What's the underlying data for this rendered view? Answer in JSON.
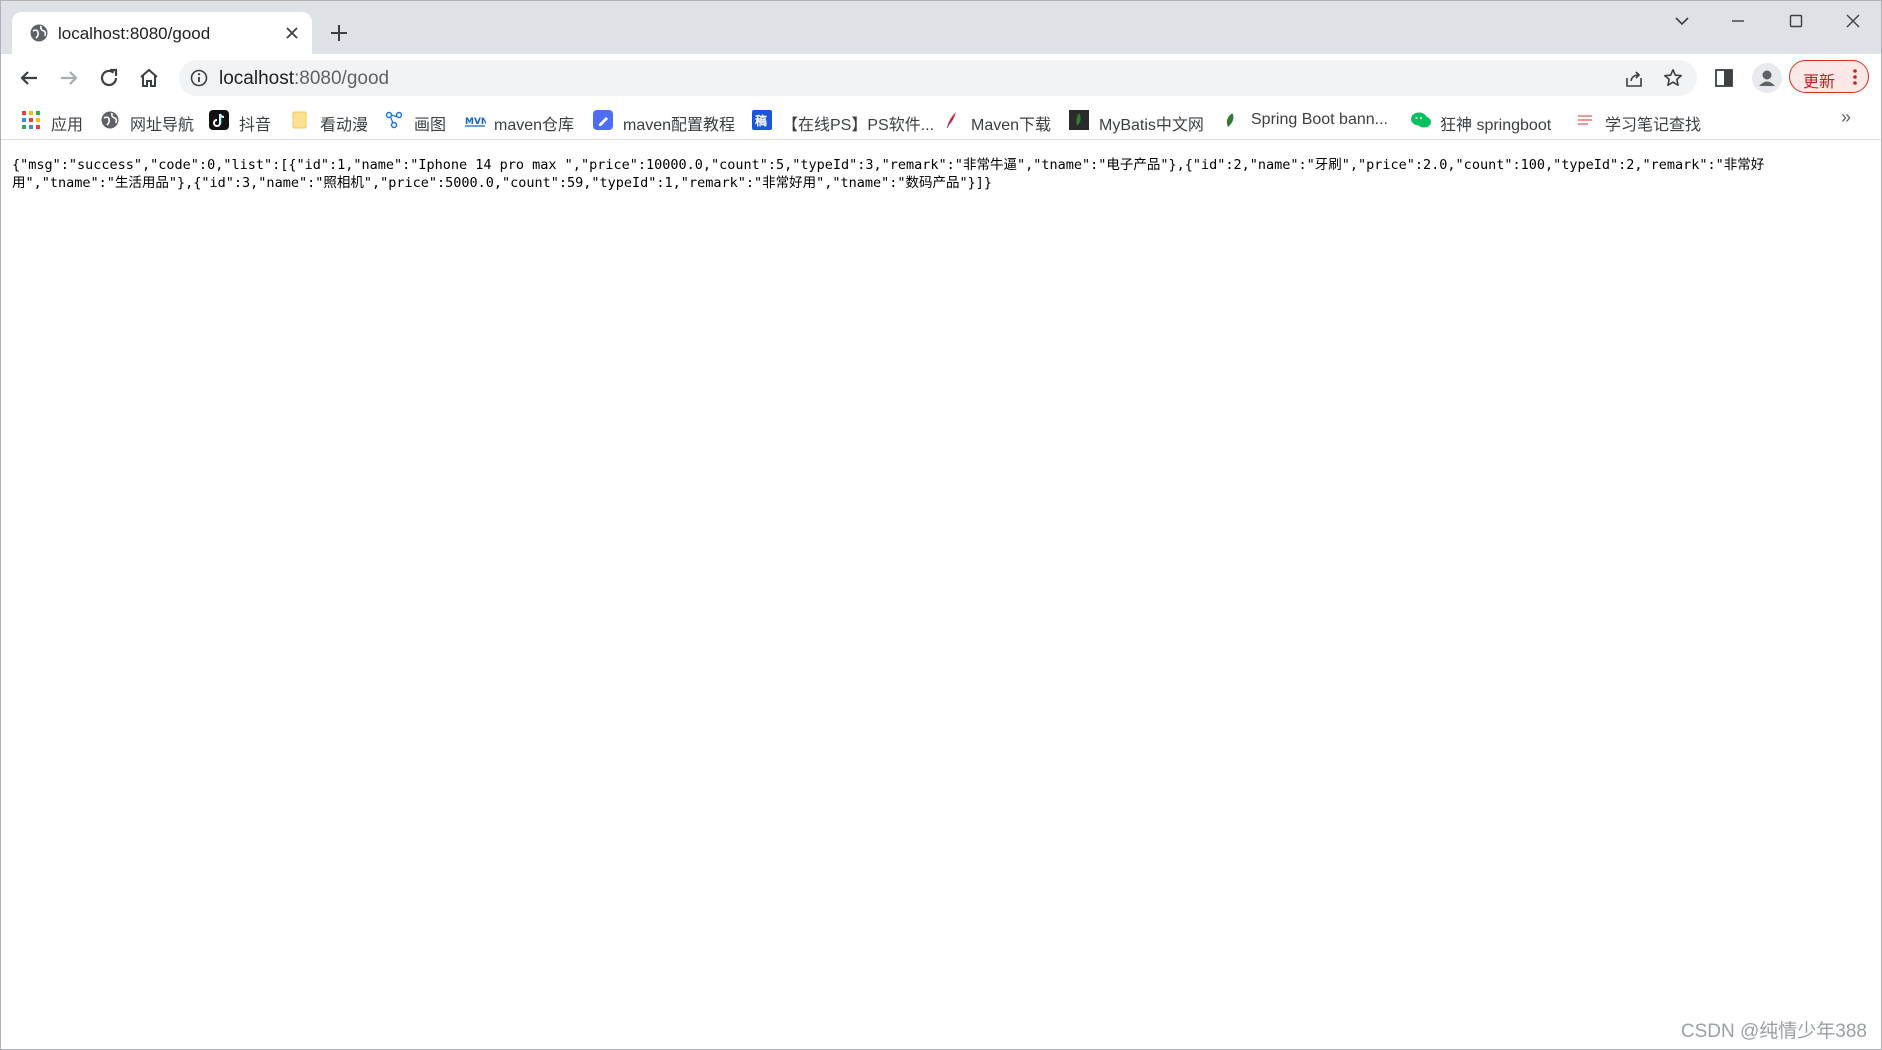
{
  "tab": {
    "title": "localhost:8080/good"
  },
  "toolbar": {
    "url_host": "localhost",
    "url_path": ":8080/good",
    "update_label": "更新"
  },
  "bookmarks": [
    {
      "label": "应用",
      "icon": "apps-grid-icon"
    },
    {
      "label": "网址导航",
      "icon": "globe-icon"
    },
    {
      "label": "抖音",
      "icon": "douyin-icon"
    },
    {
      "label": "看动漫",
      "icon": "folder-icon"
    },
    {
      "label": "画图",
      "icon": "graph-icon"
    },
    {
      "label": "maven仓库",
      "icon": "mvn-icon"
    },
    {
      "label": "maven配置教程",
      "icon": "doc-icon"
    },
    {
      "label": "【在线PS】PS软件...",
      "icon": "ps-icon"
    },
    {
      "label": "Maven下载",
      "icon": "feather-icon"
    },
    {
      "label": "MyBatis中文网",
      "icon": "mybatis-icon"
    },
    {
      "label": "Spring Boot bann...",
      "icon": "leaf-icon"
    },
    {
      "label": "狂神 springboot",
      "icon": "wechat-icon"
    },
    {
      "label": "学习笔记查找",
      "icon": "notes-icon"
    }
  ],
  "page": {
    "json_text": "{\"msg\":\"success\",\"code\":0,\"list\":[{\"id\":1,\"name\":\"Iphone 14 pro max \",\"price\":10000.0,\"count\":5,\"typeId\":3,\"remark\":\"非常牛逼\",\"tname\":\"电子产品\"},{\"id\":2,\"name\":\"牙刷\",\"price\":2.0,\"count\":100,\"typeId\":2,\"remark\":\"非常好用\",\"tname\":\"生活用品\"},{\"id\":3,\"name\":\"照相机\",\"price\":5000.0,\"count\":59,\"typeId\":1,\"remark\":\"非常好用\",\"tname\":\"数码产品\"}]}"
  },
  "watermark": "CSDN @纯情少年388",
  "colors": {
    "tabstrip": "#dee1e6",
    "omnibox": "#f1f3f4",
    "update_border": "#d93025"
  }
}
